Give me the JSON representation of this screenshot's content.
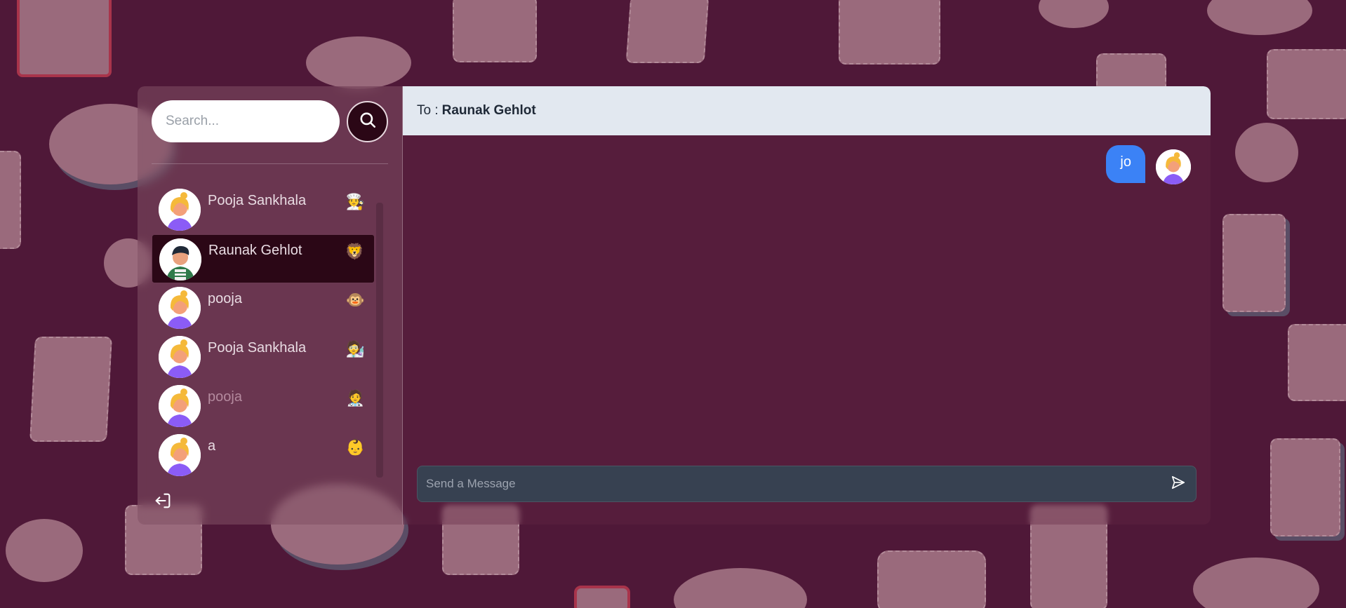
{
  "search": {
    "placeholder": "Search..."
  },
  "contacts": [
    {
      "name": "Pooja Sankhala",
      "emoji": "🧑‍🍳",
      "avatar": "female-avatar",
      "active": false,
      "dim": false
    },
    {
      "name": "Raunak Gehlot",
      "emoji": "🦁",
      "avatar": "male-avatar",
      "active": true,
      "dim": false
    },
    {
      "name": "pooja",
      "emoji": "🐵",
      "avatar": "female-avatar",
      "active": false,
      "dim": false
    },
    {
      "name": "Pooja Sankhala",
      "emoji": "🧑‍🔬",
      "avatar": "female-avatar",
      "active": false,
      "dim": false
    },
    {
      "name": "pooja",
      "emoji": "🧑‍⚕️",
      "avatar": "female-avatar",
      "active": false,
      "dim": true
    },
    {
      "name": "a",
      "emoji": "👶",
      "avatar": "female-avatar",
      "active": false,
      "dim": false
    }
  ],
  "chat": {
    "to_label": "To :",
    "to_name": "Raunak Gehlot",
    "messages": [
      {
        "text": "jo",
        "sender": "self"
      }
    ],
    "composer_placeholder": "Send a Message"
  },
  "icons": {
    "search": "search-icon",
    "logout": "logout-icon",
    "send": "send-icon"
  },
  "colors": {
    "background": "#4f1838",
    "active_item": "#2b0716",
    "message_bubble": "#3b82f6",
    "header": "#e2e8f0",
    "composer": "#374151"
  }
}
